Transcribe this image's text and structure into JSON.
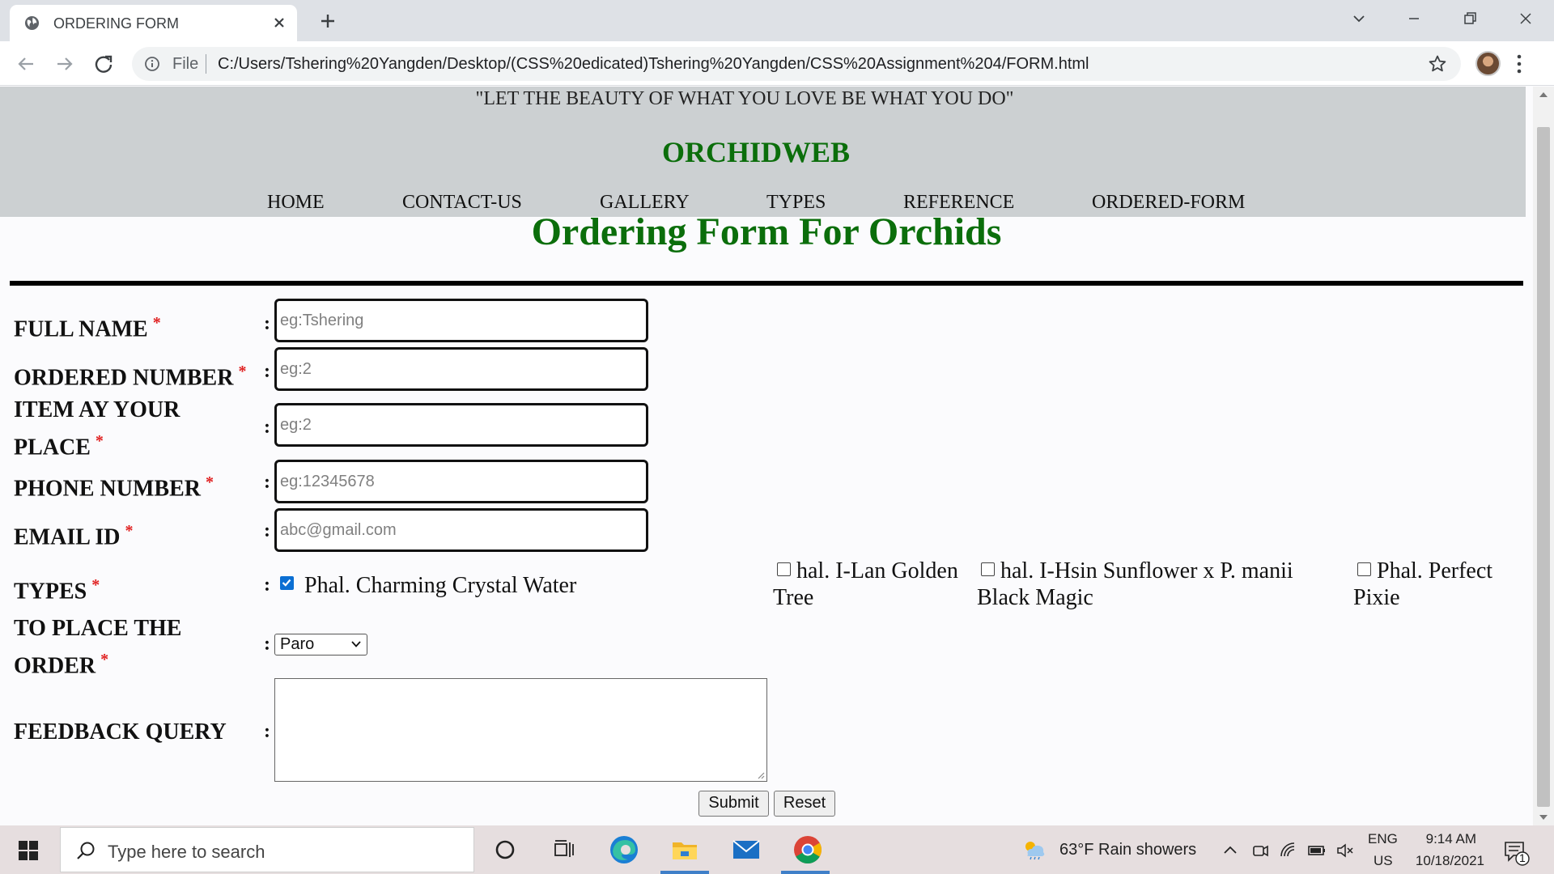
{
  "browser": {
    "tab_title": "ORDERING FORM",
    "file_label": "File",
    "url": "C:/Users/Tshering%20Yangden/Desktop/(CSS%20edicated)Tshering%20Yangden/CSS%20Assignment%204/FORM.html"
  },
  "page": {
    "quote": "\"LET THE BEAUTY OF WHAT YOU LOVE BE WHAT YOU DO\"",
    "site_name": "ORCHIDWEB",
    "nav": [
      "HOME",
      "CONTACT-US",
      "GALLERY",
      "TYPES",
      "REFERENCE",
      "ORDERED-FORM"
    ],
    "form_title": "Ordering Form For Orchids",
    "required_mark": "*",
    "colon": ":",
    "fields": {
      "full_name": {
        "label": "FULL NAME",
        "placeholder": "eg:Tshering"
      },
      "ordered_number": {
        "label": "ORDERED NUMBER",
        "placeholder": "eg:2"
      },
      "item_place": {
        "label": "ITEM AY YOUR PLACE",
        "placeholder": "eg:2"
      },
      "phone": {
        "label": "PHONE NUMBER",
        "placeholder": "eg:12345678"
      },
      "email": {
        "label": "EMAIL ID",
        "placeholder": "abc@gmail.com"
      },
      "types": {
        "label": "TYPES",
        "options": [
          {
            "label": "Phal. Charming Crystal Water",
            "checked": true
          },
          {
            "label": "hal. I-Lan Golden Tree",
            "checked": false
          },
          {
            "label": "hal. I-Hsin Sunflower x P. manii Black Magic",
            "checked": false
          },
          {
            "label": "Phal. Perfect Pixie",
            "checked": false
          }
        ]
      },
      "place_order": {
        "label": "TO PLACE THE ORDER",
        "selected": "Paro"
      },
      "feedback": {
        "label": "FEEDBACK QUERY",
        "value": ""
      }
    },
    "buttons": {
      "submit": "Submit",
      "reset": "Reset"
    }
  },
  "taskbar": {
    "search_placeholder": "Type here to search",
    "weather": "63°F  Rain showers",
    "lang_line1": "ENG",
    "lang_line2": "US",
    "time": "9:14 AM",
    "date": "10/18/2021",
    "notification_count": "1"
  }
}
